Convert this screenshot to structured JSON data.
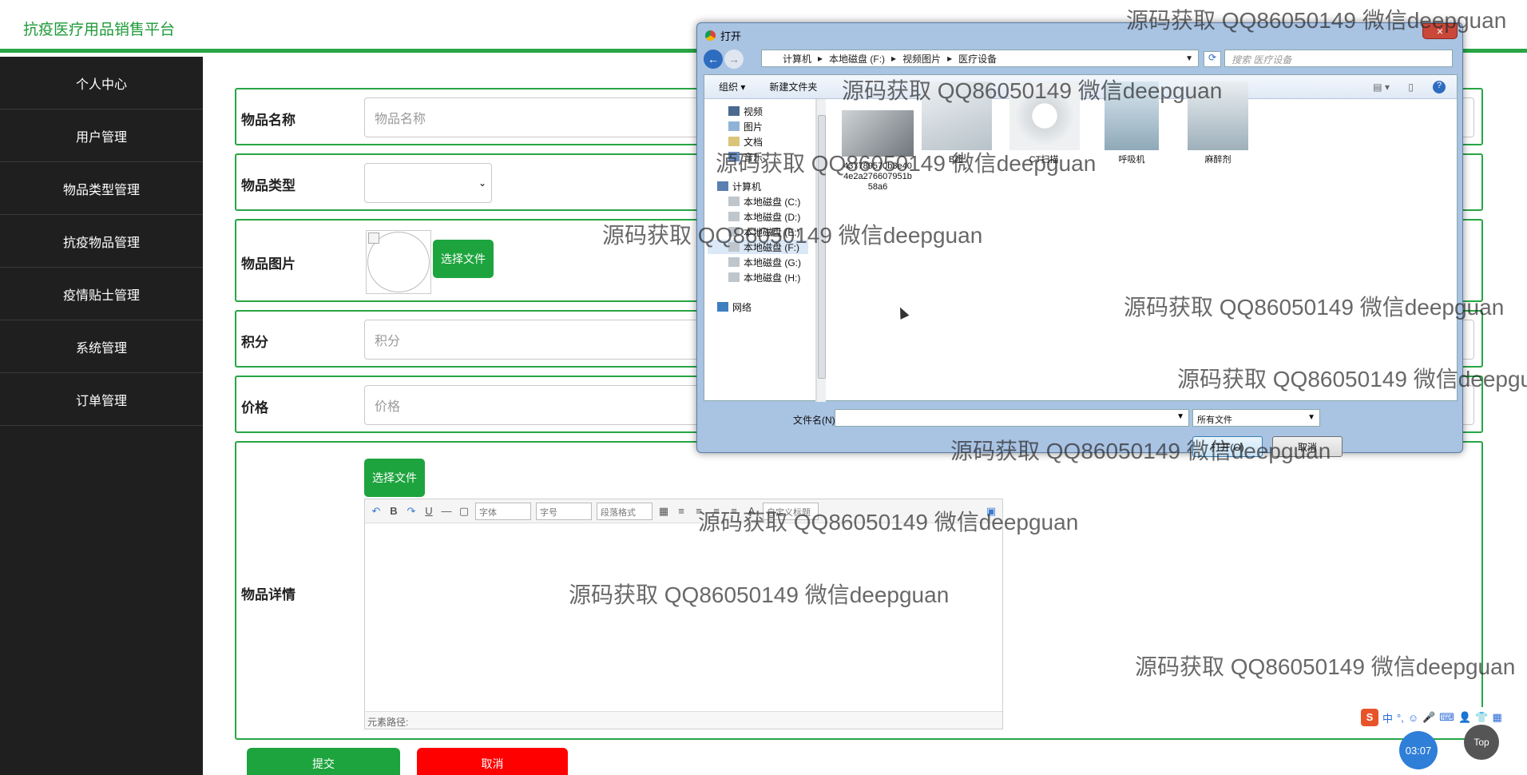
{
  "app": {
    "brand": "抗疫医疗用品销售平台"
  },
  "sidebar": {
    "items": [
      {
        "label": "个人中心"
      },
      {
        "label": "用户管理"
      },
      {
        "label": "物品类型管理"
      },
      {
        "label": "抗疫物品管理"
      },
      {
        "label": "疫情贴士管理"
      },
      {
        "label": "系统管理"
      },
      {
        "label": "订单管理"
      }
    ]
  },
  "form": {
    "name": {
      "label": "物品名称",
      "placeholder": "物品名称"
    },
    "type": {
      "label": "物品类型",
      "value": ""
    },
    "image": {
      "label": "物品图片",
      "button": "选择文件"
    },
    "points": {
      "label": "积分",
      "placeholder": "积分"
    },
    "price": {
      "label": "价格",
      "placeholder": "价格"
    },
    "detail": {
      "label": "物品详情",
      "button": "选择文件"
    },
    "editor": {
      "toolbar": {
        "font": "字体",
        "size": "字号",
        "paragraph": "段落格式",
        "custom": "自定义标题"
      },
      "path_label": "元素路径:"
    },
    "submit": "提交",
    "cancel": "取消"
  },
  "dialog": {
    "title": "打开",
    "close": "×",
    "breadcrumb": [
      "计算机",
      "本地磁盘 (F:)",
      "视频图片",
      "医疗设备"
    ],
    "search_placeholder": "搜索 医疗设备",
    "commands": {
      "organize": "组织 ▾",
      "new_folder": "新建文件夹"
    },
    "tree": [
      {
        "label": "视频",
        "icon": "video-folder-icon"
      },
      {
        "label": "图片",
        "icon": "picture-folder-icon"
      },
      {
        "label": "文档",
        "icon": "document-folder-icon"
      },
      {
        "label": "音乐",
        "icon": "music-folder-icon"
      },
      {
        "label": "计算机",
        "icon": "computer-icon"
      },
      {
        "label": "本地磁盘 (C:)",
        "icon": "drive-icon"
      },
      {
        "label": "本地磁盘 (D:)",
        "icon": "drive-icon"
      },
      {
        "label": "本地磁盘 (E:)",
        "icon": "drive-icon"
      },
      {
        "label": "本地磁盘 (F:)",
        "icon": "drive-icon",
        "selected": true
      },
      {
        "label": "本地磁盘 (G:)",
        "icon": "drive-icon"
      },
      {
        "label": "本地磁盘 (H:)",
        "icon": "drive-icon"
      },
      {
        "label": "网络",
        "icon": "network-icon"
      }
    ],
    "files": [
      {
        "name": "437789570b3e404e2a276607951b58a6"
      },
      {
        "name": "B超"
      },
      {
        "name": "CT扫描"
      },
      {
        "name": "呼吸机"
      },
      {
        "name": "麻醉剂"
      }
    ],
    "filename_label": "文件名(N):",
    "filename_value": "",
    "filetype": "所有文件",
    "open": "打开(O)",
    "cancel": "取消"
  },
  "watermark": "源码获取 QQ86050149 微信deepguan",
  "widgets": {
    "timer": "03:07",
    "top": "Top",
    "ime": "中"
  },
  "colors": {
    "primary": "#1ea43e",
    "danger": "#ff0000",
    "sidebar_bg": "#1f1f1f"
  }
}
